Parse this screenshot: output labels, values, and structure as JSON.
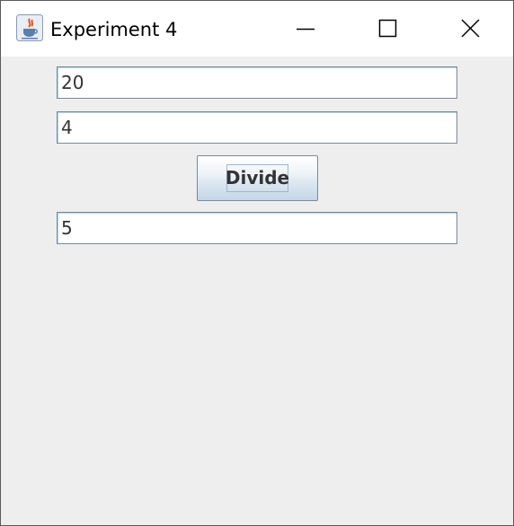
{
  "window": {
    "title": "Experiment 4",
    "app_icon": "java-cup-icon",
    "controls": [
      "minimize-icon",
      "maximize-icon",
      "close-icon"
    ]
  },
  "form": {
    "dividend_value": "20",
    "divisor_value": "4",
    "divide_label": "Divide",
    "result_value": "5"
  },
  "colors": {
    "background": "#eeeeee",
    "titlebar": "#ffffff",
    "field_border": "#7a8a99",
    "button_gradient_top": "#ffffff",
    "button_gradient_bottom": "#c6d6e6"
  }
}
